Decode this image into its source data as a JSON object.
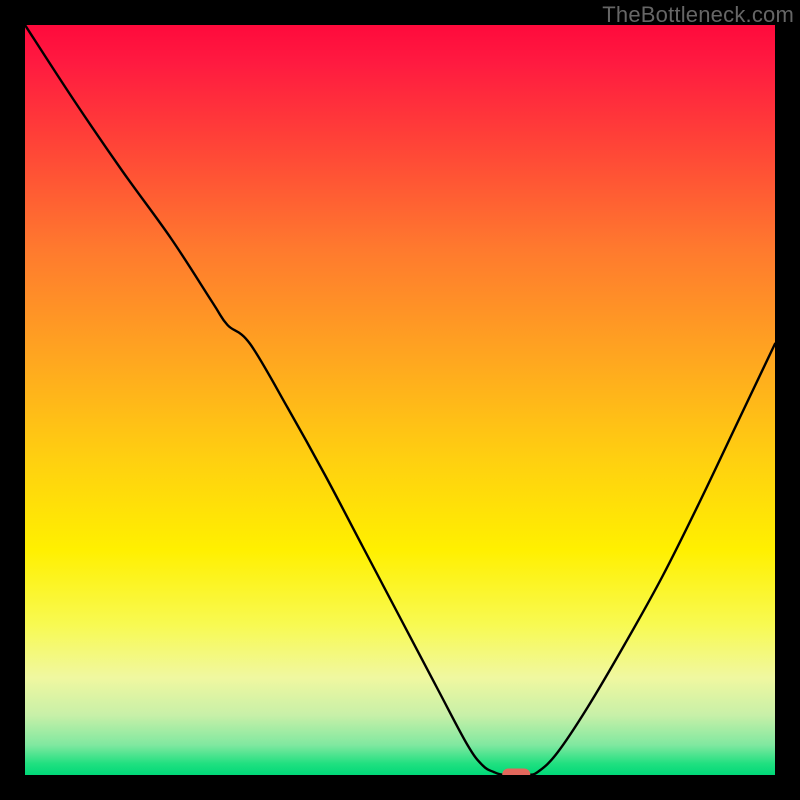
{
  "watermark": {
    "text": "TheBottleneck.com"
  },
  "chart_data": {
    "type": "line",
    "title": "",
    "xlabel": "",
    "ylabel": "",
    "xlim": [
      0,
      100
    ],
    "ylim": [
      0,
      100
    ],
    "grid": false,
    "legend": false,
    "background_gradient": {
      "orientation": "vertical",
      "stops": [
        {
          "pos": 0.0,
          "color": "#ff0a3c"
        },
        {
          "pos": 0.05,
          "color": "#ff1a40"
        },
        {
          "pos": 0.15,
          "color": "#ff4038"
        },
        {
          "pos": 0.3,
          "color": "#ff7a2e"
        },
        {
          "pos": 0.45,
          "color": "#ffa81f"
        },
        {
          "pos": 0.58,
          "color": "#ffd010"
        },
        {
          "pos": 0.7,
          "color": "#fff000"
        },
        {
          "pos": 0.8,
          "color": "#f8fa52"
        },
        {
          "pos": 0.87,
          "color": "#f0f8a0"
        },
        {
          "pos": 0.92,
          "color": "#c8f0a8"
        },
        {
          "pos": 0.96,
          "color": "#80e8a0"
        },
        {
          "pos": 0.985,
          "color": "#20e080"
        },
        {
          "pos": 1.0,
          "color": "#00d878"
        }
      ]
    },
    "series": [
      {
        "name": "bottleneck-curve",
        "points": [
          {
            "x": 0.0,
            "y": 100.0
          },
          {
            "x": 6.5,
            "y": 90.0
          },
          {
            "x": 13.0,
            "y": 80.5
          },
          {
            "x": 19.5,
            "y": 71.5
          },
          {
            "x": 25.0,
            "y": 63.0
          },
          {
            "x": 27.0,
            "y": 60.0
          },
          {
            "x": 30.0,
            "y": 57.5
          },
          {
            "x": 35.0,
            "y": 49.0
          },
          {
            "x": 40.0,
            "y": 40.0
          },
          {
            "x": 45.0,
            "y": 30.5
          },
          {
            "x": 50.0,
            "y": 21.0
          },
          {
            "x": 55.0,
            "y": 11.5
          },
          {
            "x": 59.0,
            "y": 4.0
          },
          {
            "x": 61.0,
            "y": 1.3
          },
          {
            "x": 62.5,
            "y": 0.4
          },
          {
            "x": 64.0,
            "y": 0.0
          },
          {
            "x": 67.0,
            "y": 0.0
          },
          {
            "x": 68.5,
            "y": 0.5
          },
          {
            "x": 71.0,
            "y": 3.0
          },
          {
            "x": 75.0,
            "y": 9.0
          },
          {
            "x": 80.0,
            "y": 17.5
          },
          {
            "x": 85.0,
            "y": 26.5
          },
          {
            "x": 90.0,
            "y": 36.5
          },
          {
            "x": 95.0,
            "y": 47.0
          },
          {
            "x": 100.0,
            "y": 57.5
          }
        ]
      }
    ],
    "marker": {
      "x": 65.5,
      "y": 0.0,
      "color": "#e2675c"
    }
  }
}
